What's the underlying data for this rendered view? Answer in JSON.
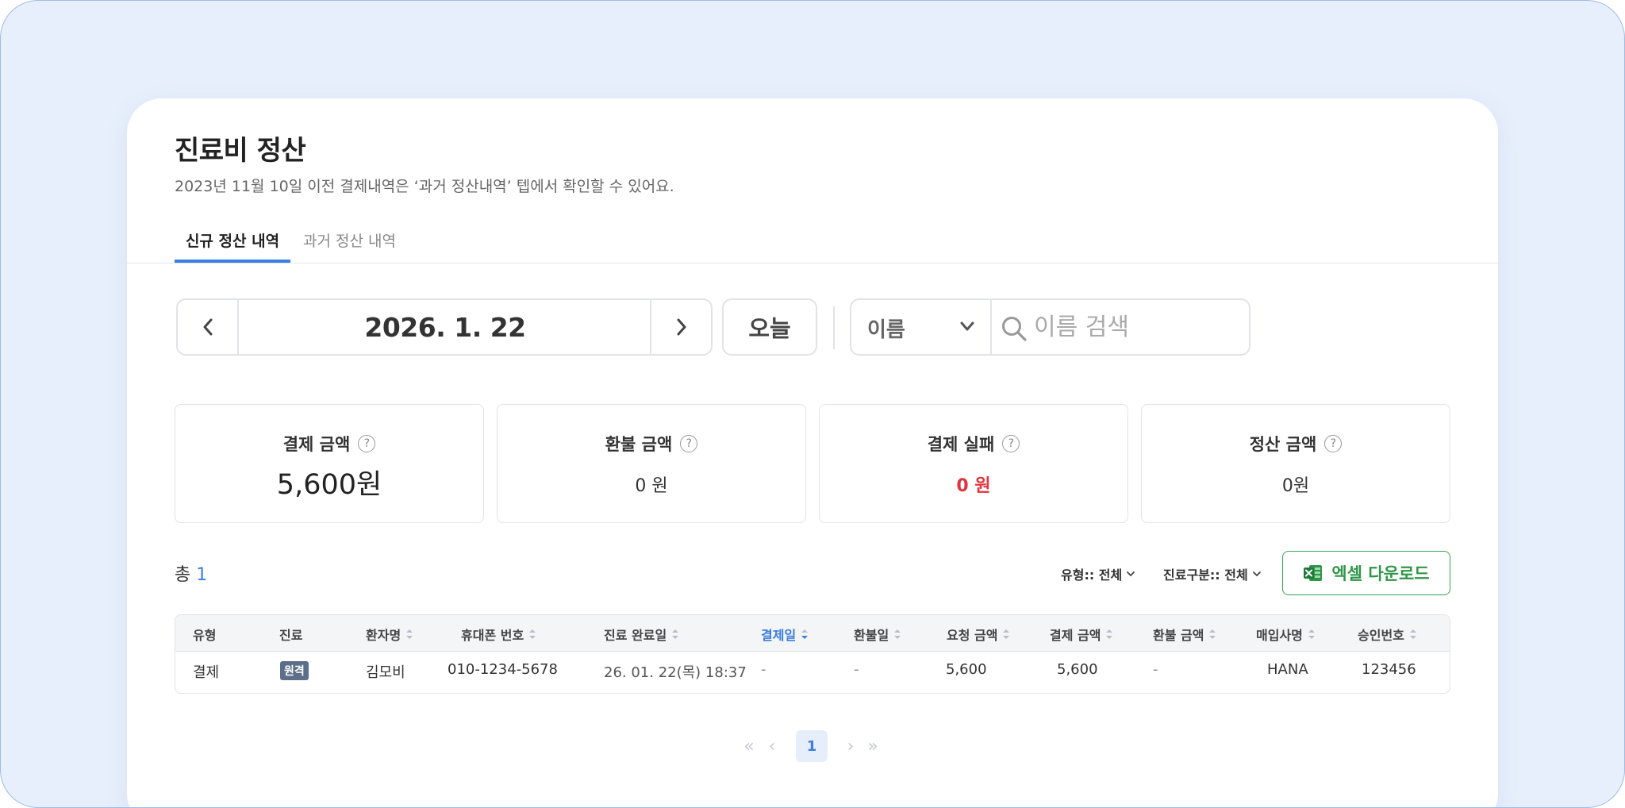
{
  "header": {
    "title": "진료비 정산",
    "subtitle": "2023년 11월 10일 이전 결제내역은 ‘과거 정산내역’ 텝에서 확인할 수 있어요."
  },
  "tabs": [
    {
      "label": "신규 정산 내역",
      "active": true
    },
    {
      "label": "과거 정산 내역",
      "active": false
    }
  ],
  "date_nav": {
    "value": "2026. 1. 22",
    "today_label": "오늘"
  },
  "search": {
    "field_label": "이름",
    "placeholder": "이름 검색",
    "value": ""
  },
  "summary": [
    {
      "label": "결제 금액",
      "value": "5,600원"
    },
    {
      "label": "환불 금액",
      "value": "0 원"
    },
    {
      "label": "결제 실패",
      "value": "0 원"
    },
    {
      "label": "정산 금액",
      "value": "0원"
    }
  ],
  "list": {
    "total_label": "총",
    "total_count": "1",
    "filters": [
      {
        "label": "유형:: 전체"
      },
      {
        "label": "진료구분:: 전체"
      }
    ],
    "excel_label": "엑셀 다운로드"
  },
  "table": {
    "columns": [
      "유형",
      "진료",
      "환자명",
      "휴대폰 번호",
      "진료 완료일",
      "결제일",
      "환불일",
      "요청 금액",
      "결제 금액",
      "환불 금액",
      "매입사명",
      "승인번호"
    ],
    "rows": [
      {
        "type": "결제",
        "care": "원격",
        "patient": "김모비",
        "phone": "010-1234-5678",
        "completed": "26. 01. 22(목) 18:37",
        "paid": "-",
        "refunded": "-",
        "requested_amount": "5,600",
        "paid_amount": "5,600",
        "refund_amount": "-",
        "acquirer": "HANA",
        "approval_no": "123456"
      }
    ]
  },
  "pagination": {
    "current": "1"
  },
  "colors": {
    "accent": "#3b7de0",
    "danger": "#e5323c",
    "excel": "#2f9648",
    "background": "#e7effc"
  }
}
